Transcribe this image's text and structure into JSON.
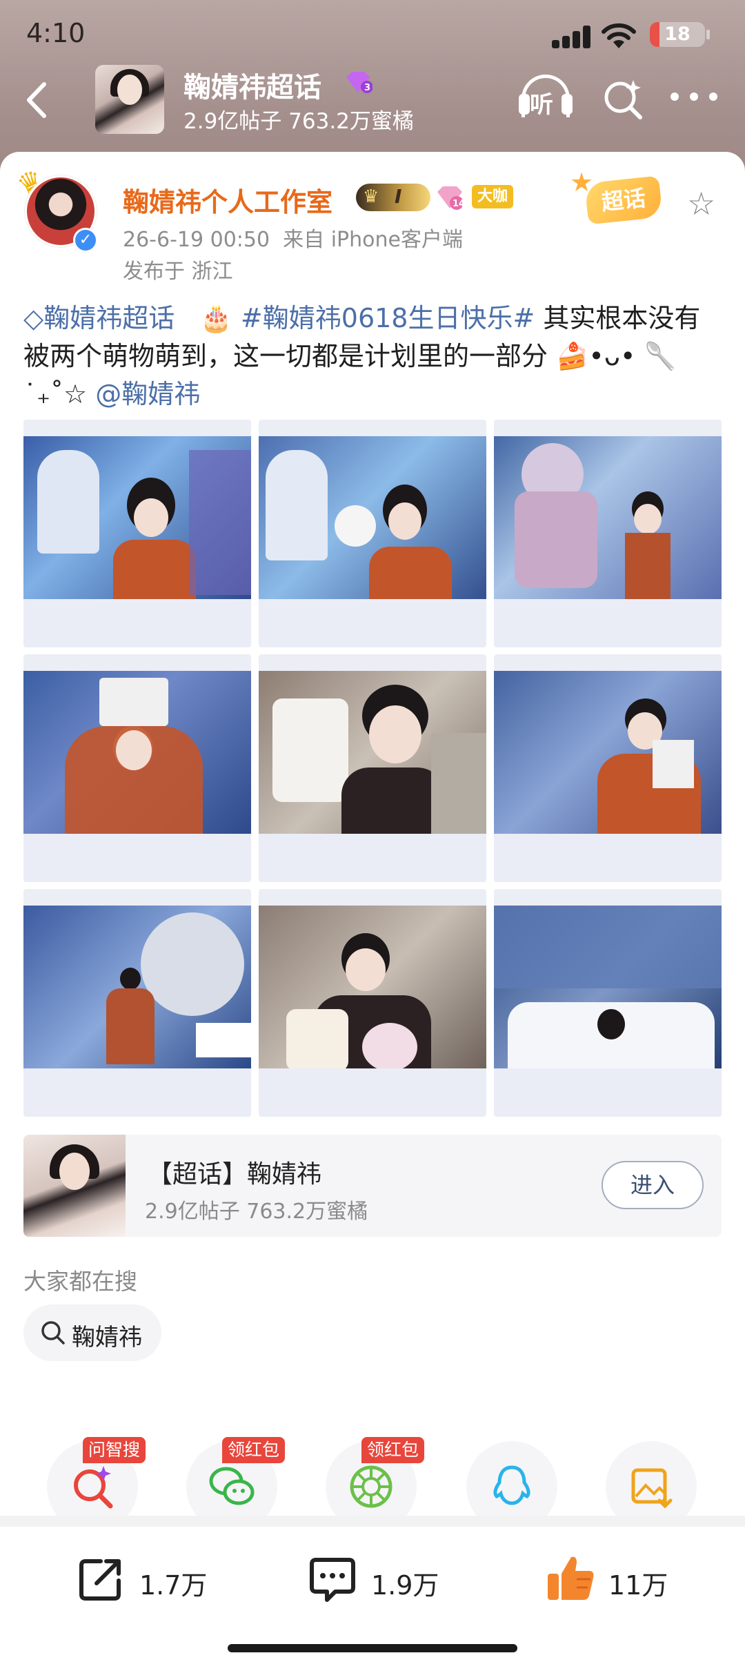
{
  "status_bar": {
    "time": "4:10",
    "battery": "18",
    "battery_level": 0.18
  },
  "header": {
    "topic_title": "鞠婧祎超话",
    "topic_stats": "2.9亿帖子 763.2万蜜橘",
    "listen_label": "听"
  },
  "post": {
    "author_name": "鞠婧祎个人工作室",
    "level_badge": "I",
    "big_badge": "大咖",
    "chaohua_tag": "超话",
    "datetime": "26-6-19 00:50",
    "source": "来自 iPhone客户端",
    "location": "发布于 浙江",
    "text_topic_link": "鞠婧祎超话",
    "text_cake": "🎂",
    "text_hashtag": "#鞠婧祎0618生日快乐#",
    "text_body": " 其实根本没有被两个萌物萌到，这一切都是计划里的一部分 🍰•ᴗ• 🥄 ˙₊˚☆ ",
    "text_mention": "@鞠婧祎",
    "images": [
      "photo-1",
      "photo-2",
      "photo-3",
      "photo-4",
      "photo-5",
      "photo-6",
      "photo-7",
      "photo-8",
      "photo-9"
    ]
  },
  "topic_card": {
    "title": "【超话】鞠婧祎",
    "stats": "2.9亿帖子 763.2万蜜橘",
    "enter_label": "进入"
  },
  "search_section": {
    "title": "大家都在搜",
    "chip": "鞠婧祎"
  },
  "share": [
    {
      "icon": "ai-search-icon",
      "tag": "问智搜"
    },
    {
      "icon": "wechat-icon",
      "tag": "领红包"
    },
    {
      "icon": "moments-icon",
      "tag": "领红包"
    },
    {
      "icon": "qq-icon",
      "tag": ""
    },
    {
      "icon": "save-image-icon",
      "tag": ""
    }
  ],
  "actions": {
    "repost": "1.7万",
    "comment": "1.9万",
    "like": "11万"
  },
  "colors": {
    "author_name": "#e8691a",
    "link": "#4c6fa8",
    "red_tag": "#e8463c"
  }
}
